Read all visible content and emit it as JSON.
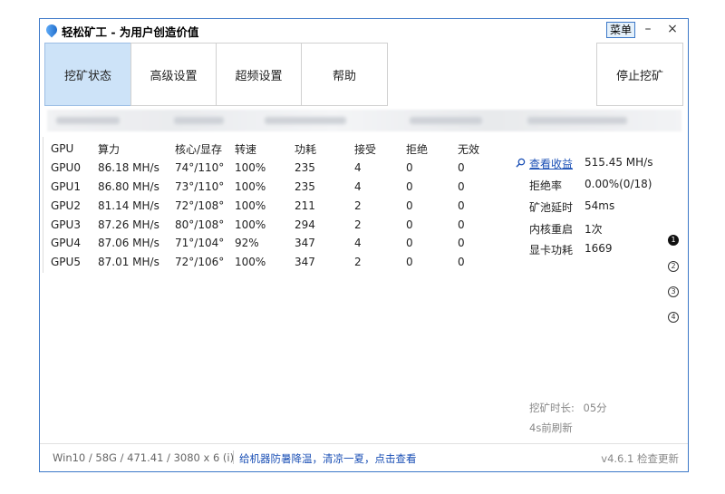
{
  "window": {
    "title": "轻松矿工 - 为用户创造价值",
    "menu_label": "菜单",
    "minimize": "–",
    "close": "×"
  },
  "toolbar": {
    "tabs": [
      "挖矿状态",
      "高级设置",
      "超频设置",
      "帮助"
    ],
    "stop_label": "停止挖矿"
  },
  "table": {
    "headers": [
      "GPU",
      "算力",
      "核心/显存",
      "转速",
      "功耗",
      "接受",
      "拒绝",
      "无效"
    ],
    "rows": [
      [
        "GPU0",
        "86.18 MH/s",
        "74°/110°",
        "100%",
        "235",
        "4",
        "0",
        "0"
      ],
      [
        "GPU1",
        "86.80 MH/s",
        "73°/110°",
        "100%",
        "235",
        "4",
        "0",
        "0"
      ],
      [
        "GPU2",
        "81.14 MH/s",
        "72°/108°",
        "100%",
        "211",
        "2",
        "0",
        "0"
      ],
      [
        "GPU3",
        "87.26 MH/s",
        "80°/108°",
        "100%",
        "294",
        "2",
        "0",
        "0"
      ],
      [
        "GPU4",
        "87.06 MH/s",
        "71°/104°",
        "92%",
        "347",
        "4",
        "0",
        "0"
      ],
      [
        "GPU5",
        "87.01 MH/s",
        "72°/106°",
        "100%",
        "347",
        "2",
        "0",
        "0"
      ]
    ]
  },
  "stats": {
    "earnings_link": "查看收益",
    "total_hashrate": "515.45 MH/s",
    "reject_rate_label": "拒绝率",
    "reject_rate_value": "0.00%(0/18)",
    "pool_latency_label": "矿池延时",
    "pool_latency_value": "54ms",
    "kernel_restart_label": "内核重启",
    "kernel_restart_value": "1次",
    "gpu_power_label": "显卡功耗",
    "gpu_power_value": "1669"
  },
  "pager": [
    "1",
    "2",
    "3",
    "4"
  ],
  "mining_time": {
    "label": "挖矿时长:",
    "value": "05分",
    "refresh": "4s前刷新"
  },
  "status": {
    "system_info": "Win10 / 58G / 471.41 / 3080 x 6 (i)",
    "cooling_link": "给机器防暑降温，清凉一夏，点击查看",
    "version": "v4.6.1 检查更新"
  },
  "colors": {
    "accent": "#3c78c8",
    "active_tab": "#cde3f8",
    "link": "#1a4fb5"
  }
}
